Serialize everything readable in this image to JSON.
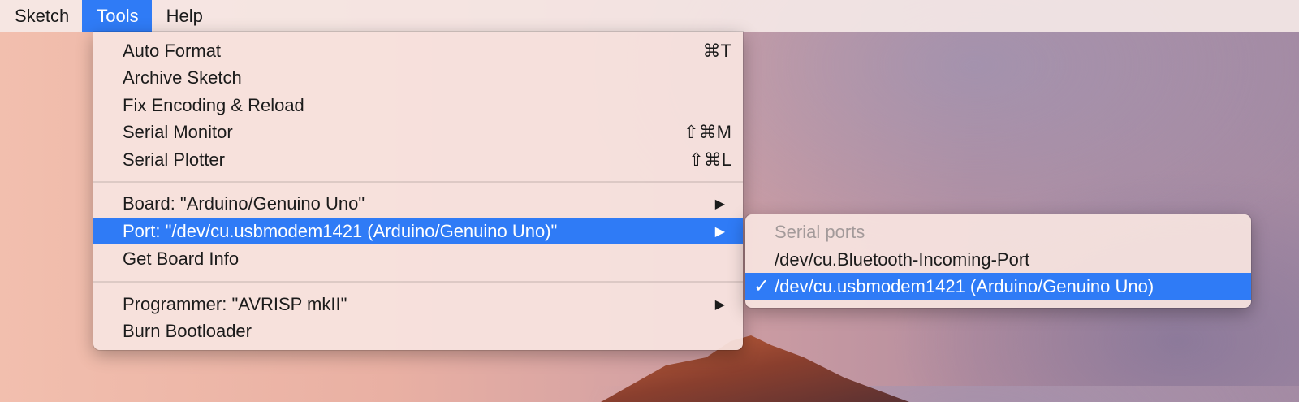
{
  "menubar": {
    "items": [
      {
        "label": "Sketch"
      },
      {
        "label": "Tools"
      },
      {
        "label": "Help"
      }
    ]
  },
  "tools_menu": {
    "groups": [
      [
        {
          "label": "Auto Format",
          "shortcut": "⌘T"
        },
        {
          "label": "Archive Sketch",
          "shortcut": ""
        },
        {
          "label": "Fix Encoding & Reload",
          "shortcut": ""
        },
        {
          "label": "Serial Monitor",
          "shortcut": "⇧⌘M"
        },
        {
          "label": "Serial Plotter",
          "shortcut": "⇧⌘L"
        }
      ],
      [
        {
          "label": "Board: \"Arduino/Genuino Uno\"",
          "submenu_arrow": "▶"
        },
        {
          "label": "Port: \"/dev/cu.usbmodem1421 (Arduino/Genuino Uno)\"",
          "submenu_arrow": "▶"
        },
        {
          "label": "Get Board Info"
        }
      ],
      [
        {
          "label": "Programmer: \"AVRISP mkII\"",
          "submenu_arrow": "▶"
        },
        {
          "label": "Burn Bootloader"
        }
      ]
    ]
  },
  "ports_submenu": {
    "header": "Serial ports",
    "items": [
      {
        "label": "/dev/cu.Bluetooth-Incoming-Port",
        "checked": false
      },
      {
        "label": "/dev/cu.usbmodem1421 (Arduino/Genuino Uno)",
        "checked": true,
        "check_mark": "✓"
      }
    ]
  },
  "colors": {
    "selection": "#2f7bf6",
    "menu_background": "#f8e4e0"
  },
  "icons": {
    "submenu": "triangle-right-icon",
    "checkmark": "checkmark-icon"
  }
}
